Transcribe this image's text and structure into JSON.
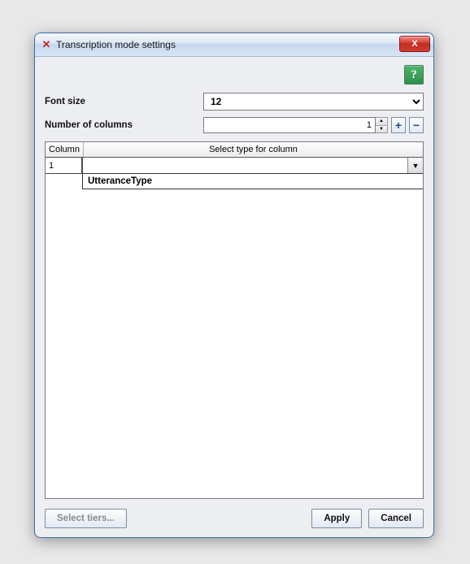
{
  "window": {
    "title": "Transcription mode settings"
  },
  "help": {
    "label": "?"
  },
  "form": {
    "font_size_label": "Font size",
    "font_size_value": "12",
    "num_columns_label": "Number of columns",
    "num_columns_value": "1"
  },
  "table": {
    "header_col1": "Column",
    "header_col2": "Select type for column",
    "rows": [
      {
        "column": "1",
        "value": ""
      }
    ],
    "dropdown_options": [
      "UtteranceType"
    ]
  },
  "buttons": {
    "select_tiers": "Select tiers...",
    "apply": "Apply",
    "cancel": "Cancel",
    "add": "+",
    "remove": "−",
    "close": "X"
  }
}
